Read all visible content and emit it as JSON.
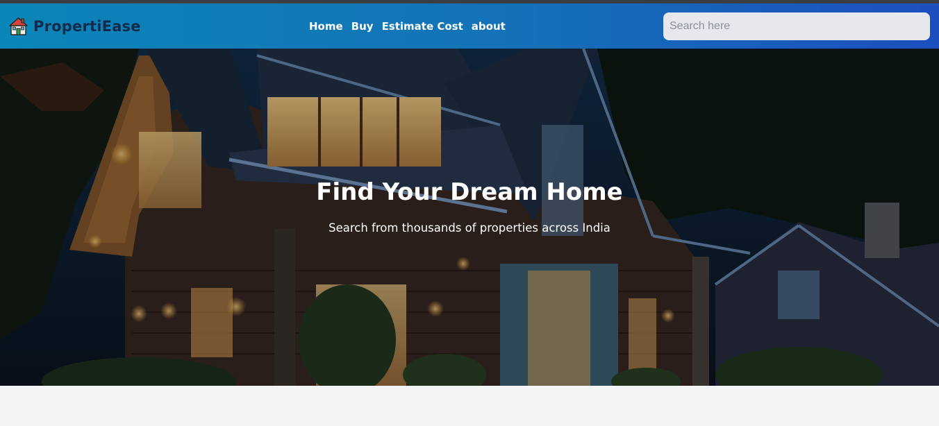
{
  "brand": {
    "name": "PropertiEase",
    "icon": "house-icon"
  },
  "nav": {
    "links": [
      {
        "label": "Home"
      },
      {
        "label": "Buy"
      },
      {
        "label": "Estimate Cost"
      },
      {
        "label": "about"
      }
    ]
  },
  "search": {
    "placeholder": "Search here",
    "value": ""
  },
  "hero": {
    "title": "Find Your Dream Home",
    "subtitle": "Search from thousands of properties across India"
  },
  "colors": {
    "navbar_start": "#0b86b8",
    "navbar_end": "#1d4fbf",
    "brand_text": "#122b4a",
    "page_background": "#f3f4f6"
  }
}
